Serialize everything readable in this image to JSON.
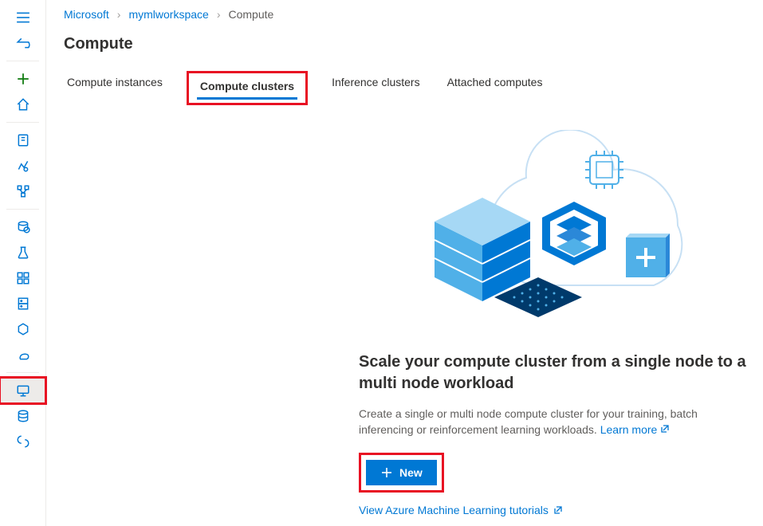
{
  "breadcrumb": {
    "items": [
      "Microsoft",
      "mymlworkspace",
      "Compute"
    ]
  },
  "page": {
    "title": "Compute"
  },
  "tabs": {
    "items": [
      {
        "label": "Compute instances"
      },
      {
        "label": "Compute clusters"
      },
      {
        "label": "Inference clusters"
      },
      {
        "label": "Attached computes"
      }
    ]
  },
  "emptyState": {
    "title": "Scale your compute cluster from a single node to a multi node workload",
    "desc": "Create a single or multi node compute cluster for your training, batch inferencing or reinforcement learning workloads. ",
    "learnMore": "Learn more",
    "newButton": "New",
    "tutorialsLink": "View Azure Machine Learning tutorials"
  },
  "sidebar": {
    "items": [
      {
        "name": "menu"
      },
      {
        "name": "back"
      },
      {
        "name": "add"
      },
      {
        "name": "home"
      },
      {
        "name": "notebooks"
      },
      {
        "name": "automl"
      },
      {
        "name": "designer"
      },
      {
        "name": "datasets"
      },
      {
        "name": "experiments"
      },
      {
        "name": "pipelines"
      },
      {
        "name": "models"
      },
      {
        "name": "endpoints"
      },
      {
        "name": "environments"
      },
      {
        "name": "compute"
      },
      {
        "name": "datastores"
      },
      {
        "name": "linked"
      }
    ]
  }
}
